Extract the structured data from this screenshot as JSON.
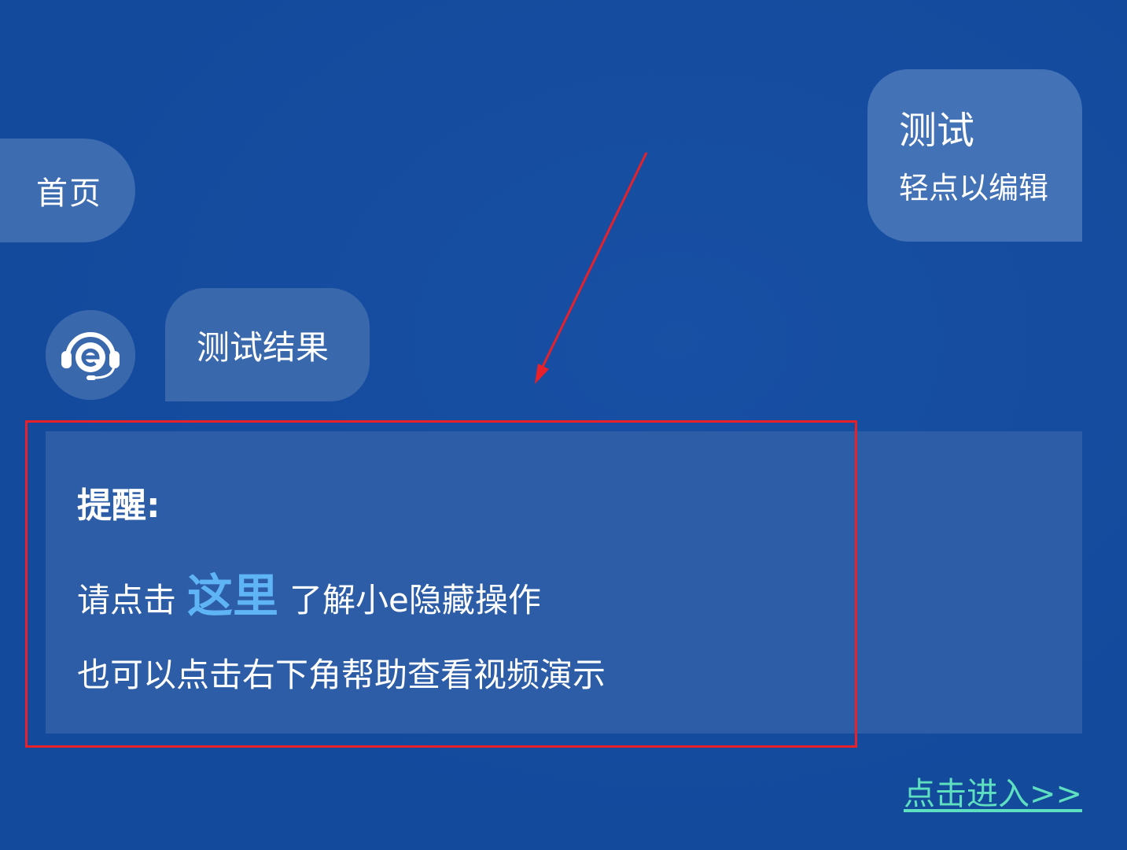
{
  "home": {
    "label": "首页"
  },
  "test_bubble": {
    "title": "测试",
    "subtitle": "轻点以编辑"
  },
  "result": {
    "text": "测试结果"
  },
  "reminder": {
    "title": "提醒:",
    "line1_prefix": "请点击",
    "here_label": "这里",
    "line1_suffix": "了解小e隐藏操作",
    "line2": "也可以点击右下角帮助查看视频演示"
  },
  "enter_link": {
    "label": "点击进入>>"
  },
  "colors": {
    "background": "#144a9c",
    "bubble": "#3d6cb0",
    "panel": "#2c5da6",
    "highlight_link": "#5fb4f5",
    "enter_link": "#5ee0c0",
    "annotation": "#e8202a"
  },
  "icons": {
    "avatar": "headset-e-icon"
  }
}
